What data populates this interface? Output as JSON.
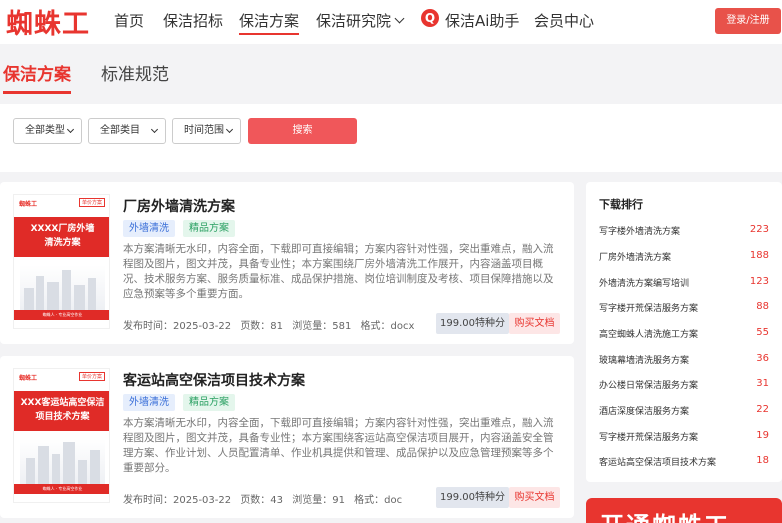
{
  "header": {
    "logo": "蜘蛛工",
    "nav": [
      "首页",
      "保洁招标",
      "保洁方案",
      "保洁研究院",
      "保洁Ai助手",
      "会员中心"
    ],
    "ai_icon_text": "Q",
    "login": "登录/注册"
  },
  "subtabs": [
    "保洁方案",
    "标准规范"
  ],
  "filters": {
    "type": "全部类型",
    "category": "全部类目",
    "time": "时间范围",
    "search": "搜索"
  },
  "cards": [
    {
      "thumb_logo": "蜘蛛工",
      "thumb_tag": "单价方案",
      "thumb_title": [
        "XXXX厂房外墙",
        "清洗方案"
      ],
      "thumb_foot": "蜘蛛人 · 专业高空作业",
      "title": "厂房外墙清洗方案",
      "tags": [
        "外墙清洗",
        "精品方案"
      ],
      "desc": "本方案清晰无水印，内容全面，下载即可直接编辑；方案内容针对性强，突出重难点，融入流程图及图片，图文并茂，具备专业性；本方案围绕厂房外墙清洗工作展开，内容涵盖项目概况、技术服务方案、服务质量标准、成品保护措施、岗位培训制度及考核、项目保障措施以及应急预案等多个重要方面。",
      "date": "发布时间：2025-03-22",
      "pages": "页数：81",
      "views": "浏览量：581",
      "format": "格式：docx",
      "price": "199.00特种分",
      "buy": "购买文档"
    },
    {
      "thumb_logo": "蜘蛛工",
      "thumb_tag": "单价方案",
      "thumb_title": [
        "XXX客运站高空保洁",
        "项目技术方案"
      ],
      "thumb_foot": "蜘蛛人 · 专业高空作业",
      "title": "客运站高空保洁项目技术方案",
      "tags": [
        "外墙清洗",
        "精品方案"
      ],
      "desc": "本方案清晰无水印，内容全面，下载即可直接编辑；方案内容针对性强，突出重难点，融入流程图及图片，图文并茂，具备专业性；本方案围绕客运站高空保洁项目展开，内容涵盖安全管理方案、作业计划、人员配置清单、作业机具提供和管理、成品保护以及应急管理预案等多个重要部分。",
      "date": "发布时间：2025-03-22",
      "pages": "页数：43",
      "views": "浏览量：91",
      "format": "格式：doc",
      "price": "199.00特种分",
      "buy": "购买文档"
    }
  ],
  "ranking": {
    "title": "下载排行",
    "items": [
      {
        "name": "写字楼外墙清洗方案",
        "count": "223"
      },
      {
        "name": "厂房外墙清洗方案",
        "count": "188"
      },
      {
        "name": "外墙清洗方案编写培训",
        "count": "123"
      },
      {
        "name": "写字楼开荒保洁服务方案",
        "count": "88"
      },
      {
        "name": "高空蜘蛛人清洗施工方案",
        "count": "55"
      },
      {
        "name": "玻璃幕墙清洗服务方案",
        "count": "36"
      },
      {
        "name": "办公楼日常保洁服务方案",
        "count": "31"
      },
      {
        "name": "酒店深度保洁服务方案",
        "count": "22"
      },
      {
        "name": "写字楼开荒保洁服务方案",
        "count": "19"
      },
      {
        "name": "客运站高空保洁项目技术方案",
        "count": "18"
      }
    ]
  },
  "promo": "开通蜘蛛工"
}
